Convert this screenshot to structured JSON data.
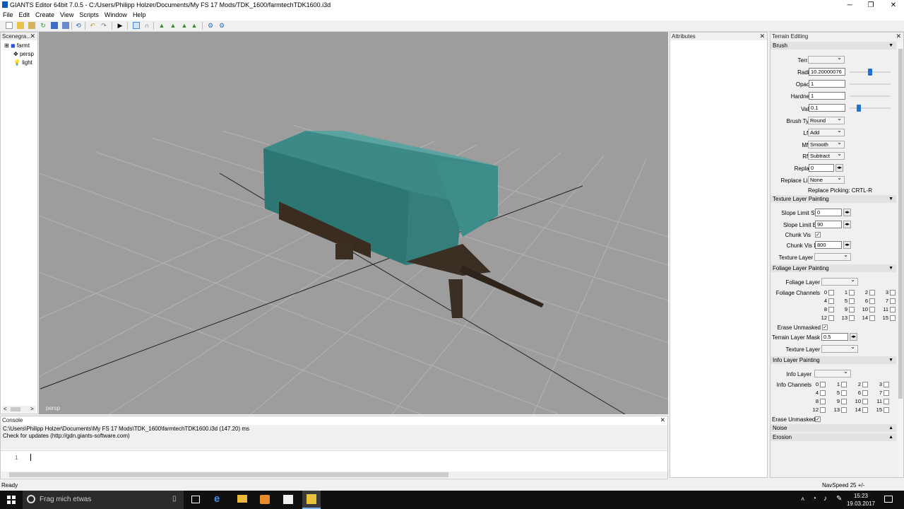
{
  "window": {
    "title": "GIANTS Editor 64bit 7.0.5 - C:/Users/Philipp Holzer/Documents/My FS 17 Mods/TDK_1600/farmtechTDK1600.i3d",
    "minimize": "─",
    "maximize": "❐",
    "close": "✕"
  },
  "menu": [
    "File",
    "Edit",
    "Create",
    "View",
    "Scripts",
    "Window",
    "Help"
  ],
  "scenegraph": {
    "title": "Scenegra...",
    "close": "✕",
    "items": [
      {
        "expander": "⊞",
        "icon": "◼",
        "label": "farmt"
      },
      {
        "expander": "",
        "icon": "✥",
        "label": "persp"
      },
      {
        "expander": "",
        "icon": "💡",
        "label": "light"
      }
    ],
    "scroll_left": "<",
    "scroll_right": ">"
  },
  "viewport": {
    "camera_label": "persp"
  },
  "attributes": {
    "title": "Attributes",
    "close": "✕"
  },
  "terrain": {
    "title": "Terrain Editing",
    "close": "✕",
    "brush": {
      "header": "Brush",
      "terrain_label": "Terrain",
      "terrain_value": "",
      "radius_label": "Radius",
      "radius_value": "10.20000076",
      "radius_level": 0.5,
      "opacity_label": "Opacity",
      "opacity_value": "1",
      "hardness_label": "Hardness",
      "hardness_value": "1",
      "value_label": "Value",
      "value_value": "0.1",
      "value_level": 0.2,
      "brush_type_label": "Brush Type",
      "brush_type_value": "Round",
      "lmb_label": "LMB",
      "lmb_value": "Add",
      "mmb_label": "MMB",
      "mmb_value": "Smooth",
      "rmb_label": "RMB",
      "rmb_value": "Subtract",
      "replace_label": "Replace",
      "replace_value": "0",
      "replace_limit_label": "Replace Limit",
      "replace_limit_value": "None",
      "replace_picking": "Replace Picking: CRTL-R"
    },
    "texture": {
      "header": "Texture Layer Painting",
      "slope_start_label": "Slope Limit Start",
      "slope_start_value": "0",
      "slope_end_label": "Slope Limit End",
      "slope_end_value": "90",
      "chunk_vis_label": "Chunk Vis",
      "chunk_vis_dist_label": "Chunk Vis Dist",
      "chunk_vis_dist_value": "800",
      "texture_layer_label": "Texture Layer"
    },
    "foliage": {
      "header": "Foliage Layer Painting",
      "foliage_layer_label": "Foliage Layer",
      "channels_label": "Foliage Channels",
      "channels": [
        "0",
        "1",
        "2",
        "3",
        "4",
        "5",
        "6",
        "7",
        "8",
        "9",
        "10",
        "11",
        "12",
        "13",
        "14",
        "15"
      ],
      "erase_unmasked_label": "Erase Unmasked",
      "terrain_layer_mask_label": "Terrain Layer Mask",
      "terrain_layer_mask_value": "0.5",
      "texture_layer_label": "Texture Layer"
    },
    "info": {
      "header": "Info Layer Painting",
      "info_layer_label": "Info Layer",
      "channels_label": "Info Channels",
      "channels": [
        "0",
        "1",
        "2",
        "3",
        "4",
        "5",
        "6",
        "7",
        "8",
        "9",
        "10",
        "11",
        "12",
        "13",
        "14",
        "15"
      ],
      "erase_unmasked_label": "Erase Unmasked"
    },
    "noise_header": "Noise",
    "erosion_header": "Erosion",
    "collapse_arrow": "▼",
    "expand_arrow": "▲",
    "spin_arrows": "◂▸",
    "check": "✓"
  },
  "console": {
    "title": "Console",
    "close": "✕",
    "lines": [
      "C:\\Users\\Philipp Holzer\\Documents\\My FS 17 Mods\\TDK_1600\\farmtechTDK1600.i3d (147.20) ms",
      "Check for updates (http://gdn.giants-software.com)"
    ],
    "line_number": "1"
  },
  "status": {
    "left": "Ready",
    "right": "NavSpeed 25 +/-"
  },
  "taskbar": {
    "search_placeholder": "Frag mich etwas",
    "time": "15:23",
    "date": "19.03.2017"
  },
  "colors": {
    "trailer": "#2f7a7a",
    "viewport": "#9d9d9d",
    "thumb": "#1e73d2"
  }
}
